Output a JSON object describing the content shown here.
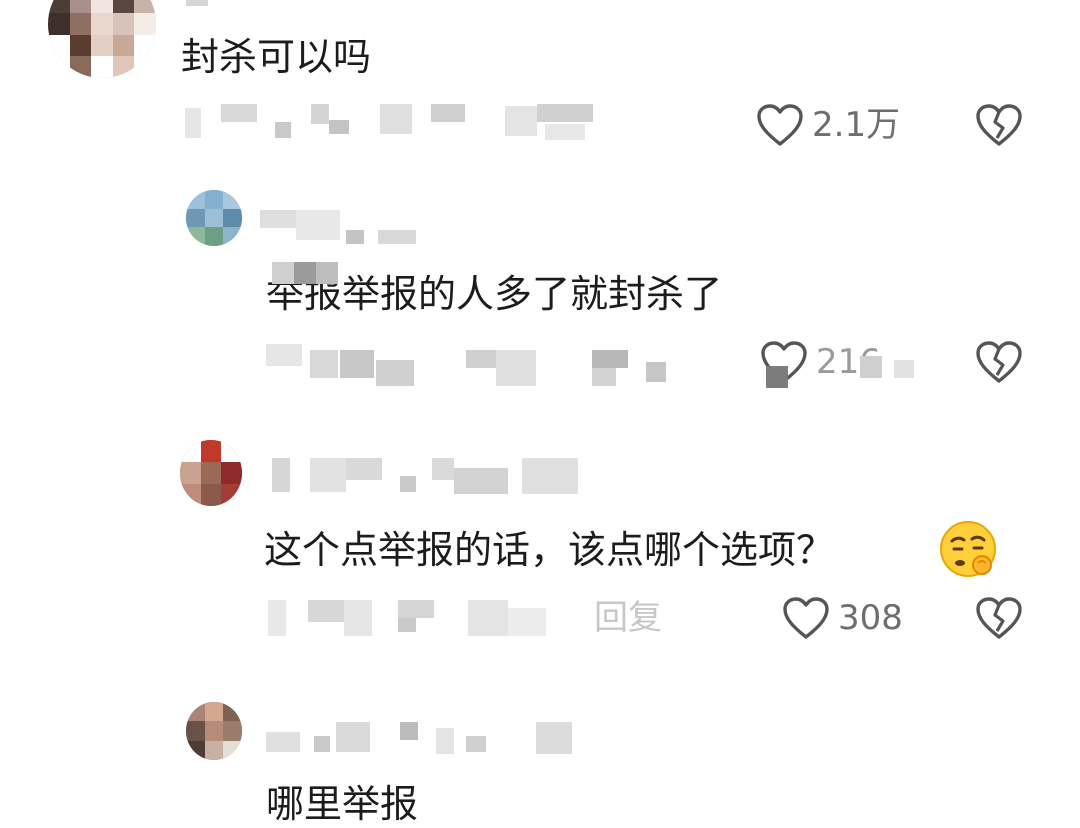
{
  "comments": [
    {
      "text": "封杀可以吗",
      "likes": "2.1万",
      "like_icon": "heart-outline-icon",
      "dislike_icon": "broken-heart-icon"
    },
    {
      "text": "举报举报的人多了就封杀了",
      "likes": "216",
      "like_icon": "heart-outline-icon",
      "dislike_icon": "broken-heart-icon"
    },
    {
      "text": "这个点举报的话，该点哪个选项？",
      "emoji": "thinking-face-emoji",
      "likes": "308",
      "reply_label": "回复",
      "like_icon": "heart-outline-icon",
      "dislike_icon": "broken-heart-icon"
    },
    {
      "text": "哪里举报"
    }
  ],
  "colors": {
    "text": "#1c1c1c",
    "meta": "#6e6e6e",
    "icon": "#555555",
    "mosaic_light": "#d8d8d8",
    "mosaic_mid": "#bdbdbd"
  }
}
